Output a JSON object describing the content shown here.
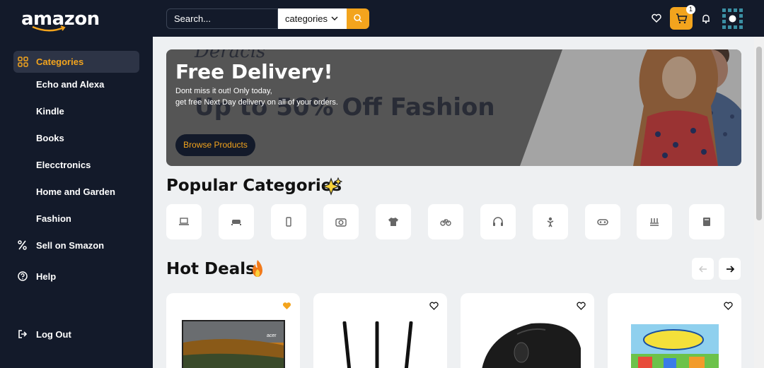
{
  "header": {
    "logo": "amazon",
    "search_placeholder": "Search...",
    "category_select": "categories",
    "cart_count": "1"
  },
  "sidebar": {
    "items": [
      {
        "label": "Categories",
        "icon": "grid-icon"
      },
      {
        "label": "Echo and Alexa"
      },
      {
        "label": "Kindle"
      },
      {
        "label": "Books"
      },
      {
        "label": "Elecctronics"
      },
      {
        "label": "Home and Garden"
      },
      {
        "label": "Fashion"
      },
      {
        "label": "Sell on Smazon",
        "icon": "percent-icon"
      },
      {
        "label": "Help",
        "icon": "help-icon"
      },
      {
        "label": "Log Out",
        "icon": "logout-icon"
      }
    ]
  },
  "banner": {
    "title": "Free Delivery!",
    "subtitle_line1": "Dont miss it out! Only today,",
    "subtitle_line2": "get free Next Day delivery on all of your orders.",
    "button": "Browse Products",
    "background_text": "Up to 50% Off Fashion",
    "background_top_text": "Deracis"
  },
  "popular": {
    "title": "Popular Categories",
    "icons": [
      "laptop-icon",
      "sofa-icon",
      "phone-icon",
      "camera-icon",
      "tshirt-icon",
      "bicycle-icon",
      "headphones-icon",
      "toy-icon",
      "gamepad-icon",
      "cake-icon",
      "book-icon"
    ]
  },
  "hot_deals": {
    "title": "Hot Deals",
    "cards": [
      {
        "image": "monitor",
        "favorited": true
      },
      {
        "image": "router",
        "favorited": false
      },
      {
        "image": "mouse",
        "favorited": false
      },
      {
        "image": "board-game",
        "favorited": false
      }
    ]
  },
  "colors": {
    "accent": "#f3a41d",
    "dark": "#131a2a"
  }
}
